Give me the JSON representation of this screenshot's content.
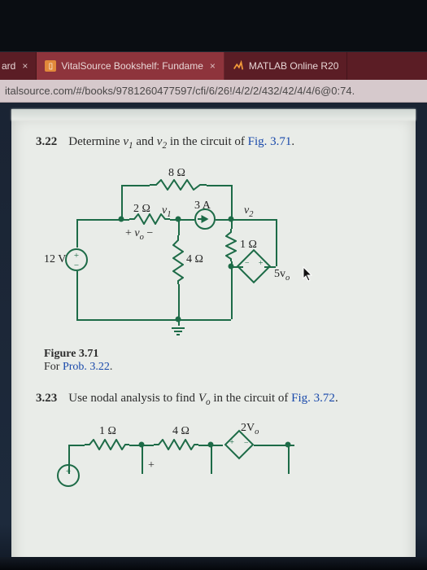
{
  "tabs": {
    "left_partial": "ard",
    "left_close": "×",
    "active_title": "VitalSource Bookshelf: Fundame",
    "active_suffix": "×",
    "right_title": "MATLAB Online R20"
  },
  "url": "italsource.com/#/books/9781260477597/cfi/6/26!/4/2/2/432/42/4/4/6@0:74.",
  "prob322": {
    "num": "3.22",
    "text_before": "Determine ",
    "v1": "v",
    "v1_sub": "1",
    "and": " and ",
    "v2": "v",
    "v2_sub": "2",
    "text_mid": " in the circuit of ",
    "figref": "Fig. 3.71",
    "period": "."
  },
  "ckt71": {
    "R8": "8 Ω",
    "R2": "2 Ω",
    "R1": "1 Ω",
    "R4": "4 Ω",
    "Isrc": "3 A",
    "Vsrc": "12 V",
    "Vdep": "5v",
    "Vdep_sub": "o",
    "v1": "v",
    "v1_sub": "1",
    "v2": "v",
    "v2_sub": "2",
    "vo_plus": "+ ",
    "vo": "v",
    "vo_sub": "o",
    "vo_minus": " −"
  },
  "figcap71": {
    "fig": "Figure 3.71",
    "for": "For ",
    "prob": "Prob. 3.22",
    "period": "."
  },
  "prob323": {
    "num": "3.23",
    "text_before": "Use nodal analysis to find ",
    "Vo": "V",
    "Vo_sub": "o",
    "text_mid": " in the circuit of ",
    "figref": "Fig. 3.72",
    "period": "."
  },
  "ckt72": {
    "R1": "1 Ω",
    "R4": "4 Ω",
    "Vdep": "2V",
    "Vdep_sub": "o",
    "plus": "+"
  }
}
